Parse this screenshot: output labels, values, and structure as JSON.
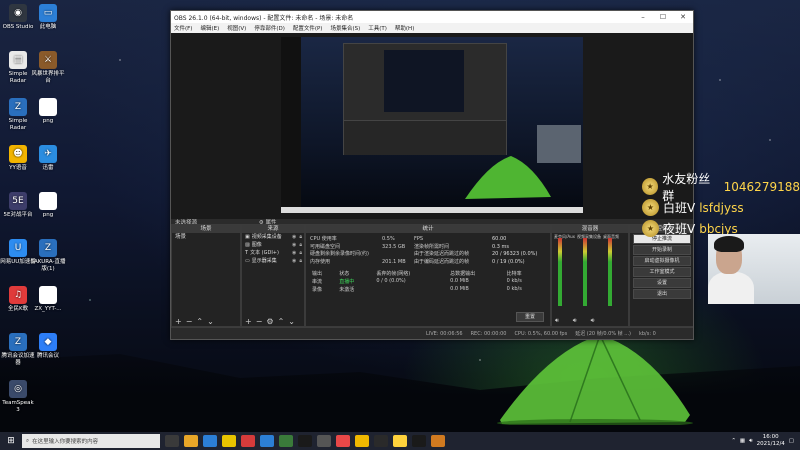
{
  "desktop": {
    "icons": [
      {
        "label": "OBS Studio",
        "glyph": "◉",
        "color": "#2f3640",
        "icon": "obs-icon"
      },
      {
        "label": "此电脑",
        "glyph": "▭",
        "color": "#2c7fd6",
        "icon": "computer-icon"
      },
      {
        "label": "Simple Radar",
        "glyph": "▤",
        "color": "#e9e9e9",
        "icon": "file-icon"
      },
      {
        "label": "风暴世界排平台",
        "glyph": "⚔",
        "color": "#8a5a2a",
        "icon": "game-icon"
      },
      {
        "label": "Simple Radar",
        "glyph": "Z",
        "color": "#2a6fbd",
        "icon": "zip-icon"
      },
      {
        "label": "png",
        "glyph": "",
        "color": "#ffffff",
        "icon": "image-file-icon"
      },
      {
        "label": "YY语音",
        "glyph": "☻",
        "color": "#f2b400",
        "icon": "yy-icon"
      },
      {
        "label": "迅雷",
        "glyph": "✈",
        "color": "#2b8de0",
        "icon": "thunder-icon"
      },
      {
        "label": "5E对战平台",
        "glyph": "5E",
        "color": "#3d3d6a",
        "icon": "5e-icon"
      },
      {
        "label": "png",
        "glyph": "",
        "color": "#ffffff",
        "icon": "image-file-icon"
      },
      {
        "label": "网易UU加速器",
        "glyph": "U",
        "color": "#2d8cf0",
        "icon": "uu-icon"
      },
      {
        "label": "SAKURA-直播版(1)",
        "glyph": "Z",
        "color": "#2a6fbd",
        "icon": "zip-icon"
      },
      {
        "label": "全民K歌",
        "glyph": "♫",
        "color": "#e03b3b",
        "icon": "karaoke-icon"
      },
      {
        "label": "ZX_YYT-...",
        "glyph": "",
        "color": "#ffffff",
        "icon": "image-file-icon"
      },
      {
        "label": "腾讯会议加速器",
        "glyph": "Z",
        "color": "#2a6fbd",
        "icon": "zip-icon"
      },
      {
        "label": "腾讯会议",
        "glyph": "◆",
        "color": "#2d7ef7",
        "icon": "meeting-icon"
      },
      {
        "label": "TeamSpeak 3",
        "glyph": "◎",
        "color": "#3a4a6a",
        "icon": "teamspeak-icon"
      }
    ]
  },
  "obs": {
    "title": "OBS 26.1.0 (64-bit, windows) - 配置文件: 未命名 - 场景: 未命名",
    "menu": [
      "文件(F)",
      "编辑(E)",
      "视图(V)",
      "停靠部件(D)",
      "配置文件(P)",
      "场景集合(S)",
      "工具(T)",
      "帮助(H)"
    ],
    "no_source": "未选择源",
    "props_label": "属性",
    "filters_label": "滤镜",
    "scenes": {
      "title": "场景",
      "items": [
        "场景"
      ]
    },
    "sources": {
      "title": "来源",
      "items": [
        {
          "name": "视频采集设备",
          "icon": "camera-icon"
        },
        {
          "name": "图像",
          "icon": "image-icon"
        },
        {
          "name": "文本 (GDI+)",
          "icon": "text-icon"
        },
        {
          "name": "显示器采集",
          "icon": "monitor-icon"
        }
      ]
    },
    "stats": {
      "title": "统计",
      "rows": [
        {
          "k1": "CPU 使用率",
          "v1": "0.5%",
          "k2": "FPS",
          "v2": "60.00"
        },
        {
          "k1": "可用磁盘空间",
          "v1": "323.5 GB",
          "k2": "渲染帧所需时间",
          "v2": "0.3 ms"
        },
        {
          "k1": "硬盘剩余剩余录像时间(约)",
          "v1": "",
          "k2": "由于渲染延迟而跳过的帧",
          "v2": "20 / 96323 (0.0%)"
        },
        {
          "k1": "内存使用",
          "v1": "201.1 MB",
          "k2": "由于编码延迟而跳过的帧",
          "v2": "0 / 19 (0.0%)"
        }
      ],
      "table_header": [
        "输出",
        "状态",
        "丢弃的帧(网络)",
        "总数据输出",
        "比特率"
      ],
      "table_rows": [
        [
          "串流",
          "直播中",
          "0 / 0 (0.0%)",
          "0.0 MiB",
          "0 kb/s"
        ],
        [
          "录像",
          "未激活",
          "",
          "0.0 MiB",
          "0 kb/s"
        ]
      ],
      "reset_label": "重置"
    },
    "mixer": {
      "title": "混音器",
      "channels": [
        "麦克风/Aux",
        "视频采集设备",
        "桌面音频"
      ]
    },
    "controls": {
      "title": "控件",
      "buttons": [
        "停止推流",
        "开始录制",
        "启动虚拟摄像机",
        "工作室模式",
        "设置",
        "退出"
      ]
    },
    "status": {
      "live": "LIVE: 00:06:56",
      "rec": "REC: 00:00:00",
      "cpu": "CPU: 0.5%, 60.00 fps",
      "dropped": "延迟 (20 帧/0.0% 帧 ...)",
      "kbps": "kb/s: 0"
    }
  },
  "overlay": {
    "rows": [
      {
        "name": "水友粉丝群",
        "value": "1046279188"
      },
      {
        "name": "白班V",
        "value": "lsfdjyss"
      },
      {
        "name": "夜班V",
        "value": "bbcjys"
      }
    ]
  },
  "taskbar": {
    "search_placeholder": "在这里输入你要搜索的内容",
    "time": "16:00",
    "date": "2021/12/4",
    "apps": [
      "#3a3a3a",
      "#e8a628",
      "#2c7fd6",
      "#e8c400",
      "#d63b3b",
      "#2c7fd6",
      "#3a7a3a",
      "#1a1a1a",
      "#555",
      "#e94848",
      "#f0b800",
      "#2a2a2a",
      "#ffd23c",
      "#1a1a1a",
      "#d07a20"
    ]
  }
}
